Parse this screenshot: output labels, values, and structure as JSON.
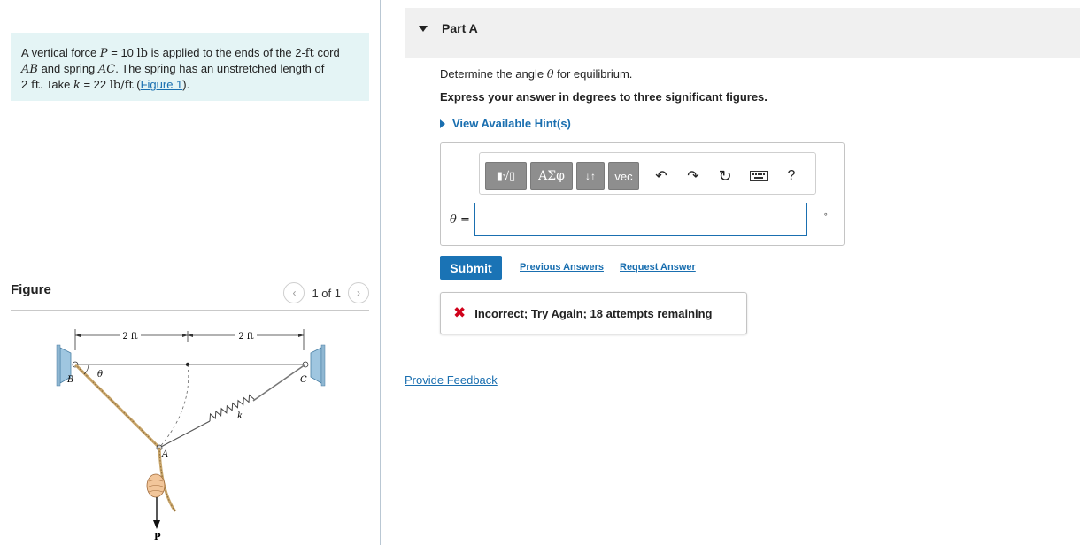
{
  "problem": {
    "t1": "A vertical force ",
    "P": "P",
    "t2": " = 10 ",
    "lb": "lb",
    "t3": " is applied to the ends of the 2-",
    "ft1": "ft",
    "t4": " cord",
    "AB": "AB",
    "t5": " and spring ",
    "AC": "AC",
    "t6": ". The spring has an unstretched length of",
    "t7": "2 ",
    "ft2": "ft",
    "t8": ". Take ",
    "k": "k",
    "t9": " = 22 ",
    "unit": "lb/ft",
    "t10": " (",
    "figure_link": "Figure 1",
    "t11": ")."
  },
  "figure": {
    "title": "Figure",
    "pager": "1 of 1",
    "prev_icon": "chevron-left-icon",
    "next_icon": "chevron-right-icon",
    "labels": {
      "dim1": "2 ft",
      "dim2": "2 ft",
      "B": "B",
      "C": "C",
      "theta": "θ",
      "k": "k",
      "A": "A",
      "P": "P"
    }
  },
  "part": {
    "title": "Part A",
    "question": "Determine the angle ",
    "theta": "θ",
    "question_end": " for equilibrium.",
    "instruction": "Express your answer in degrees to three significant figures.",
    "hint": "View Available Hint(s)"
  },
  "toolbar": {
    "templates": "▮√▯",
    "greek": "ΑΣφ",
    "arrows": "↓↑",
    "vec": "vec",
    "undo": "↶",
    "redo": "↷",
    "reset": "↻",
    "keyboard_icon": "keyboard-icon",
    "help": "?"
  },
  "answer": {
    "label": "θ =",
    "value": "",
    "unit": "∘"
  },
  "actions": {
    "submit": "Submit",
    "previous": "Previous Answers",
    "request": "Request Answer"
  },
  "feedback": {
    "message": "Incorrect; Try Again; 18 attempts remaining"
  },
  "footer": {
    "provide_feedback": "Provide Feedback"
  },
  "colors": {
    "accent": "#1a73b5",
    "problem_bg": "#e4f4f5",
    "error": "#d0021b"
  }
}
